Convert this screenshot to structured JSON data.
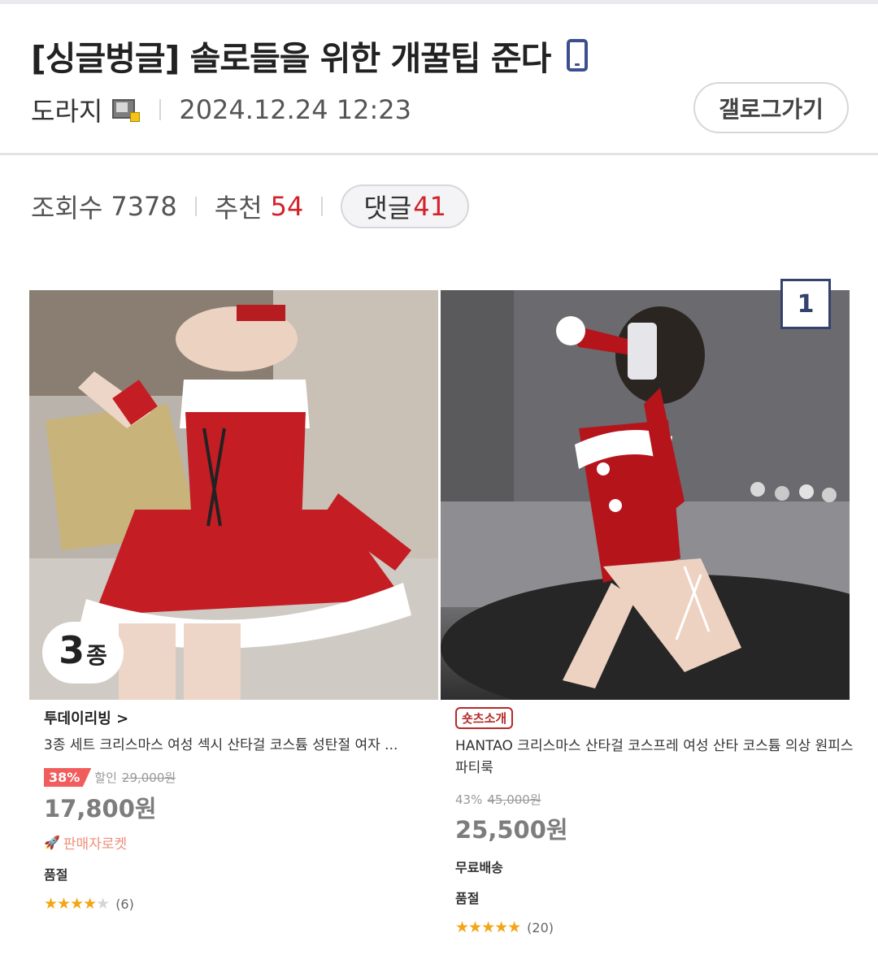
{
  "post": {
    "title": "[싱글벙글] 솔로들을 위한 개꿀팁 준다",
    "title_icon": "mobile-phone-icon",
    "author": "도라지",
    "author_icon": "user-level-badge-icon",
    "date": "2024.12.24 12:23",
    "gallery_button": "갤로그가기"
  },
  "stats": {
    "views_label": "조회수",
    "views": "7378",
    "recommend_label": "추천",
    "recommend": "54",
    "comments_label": "댓글",
    "comments": "41"
  },
  "colors": {
    "accent_red": "#d3232a",
    "badge_navy": "#34426e",
    "star": "#f4a516"
  },
  "image": {
    "index_badge": "1",
    "left_badge_number": "3",
    "left_badge_unit": "종"
  },
  "products": [
    {
      "store": "투데이리빙 >",
      "name": "3종 세트 크리스마스 여성 섹시 산타걸 코스튬 성탄절 여자 ...",
      "discount_pct": "38%",
      "discount_label": "할인",
      "original_price": "29,000원",
      "price": "17,800원",
      "seller_tag": "판매자로켓",
      "quality_label": "품절",
      "stars": 4,
      "review_count": "(6)"
    },
    {
      "promo_tag": "숏츠소개",
      "name": "HANTAO 크리스마스 산타걸 코스프레 여성 산타 코스튬 의상 원피스 파티룩",
      "discount_pct": "43%",
      "original_price": "45,000원",
      "price": "25,500원",
      "shipping": "무료배송",
      "quality_label": "품절",
      "stars": 5,
      "review_count": "(20)"
    }
  ]
}
